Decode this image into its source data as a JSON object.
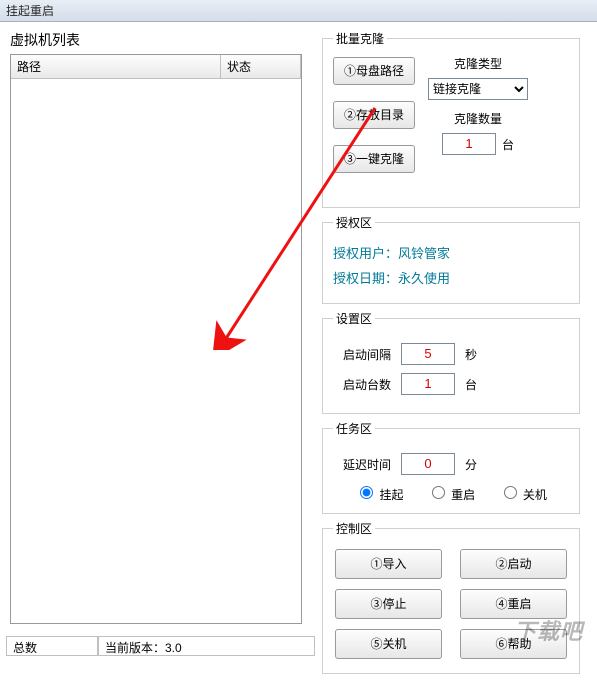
{
  "window": {
    "title": "挂起重启"
  },
  "left": {
    "list_label": "虚拟机列表",
    "col_path": "路径",
    "col_status": "状态"
  },
  "clone": {
    "legend": "批量克隆",
    "btn_base_disk": "①母盘路径",
    "btn_store": "②存放目录",
    "btn_one_key": "③一键克隆",
    "type_label": "克隆类型",
    "type_value": "链接克隆",
    "count_label": "克隆数量",
    "count_value": "1",
    "count_unit": "台"
  },
  "auth": {
    "legend": "授权区",
    "user_line": "授权用户：风铃管家",
    "date_line": "授权日期：永久使用"
  },
  "settings": {
    "legend": "设置区",
    "interval_label": "启动间隔",
    "interval_value": "5",
    "interval_unit": "秒",
    "count_label": "启动台数",
    "count_value": "1",
    "count_unit": "台"
  },
  "task": {
    "legend": "任务区",
    "delay_label": "延迟时间",
    "delay_value": "0",
    "delay_unit": "分",
    "radio_suspend": "挂起",
    "radio_restart": "重启",
    "radio_shutdown": "关机",
    "selected": "suspend"
  },
  "control": {
    "legend": "控制区",
    "btn_import": "①导入",
    "btn_start": "②启动",
    "btn_stop": "③停止",
    "btn_restart": "④重启",
    "btn_shutdown": "⑤关机",
    "btn_help": "⑥帮助"
  },
  "status": {
    "total_label": "总数",
    "version_label": "当前版本：3.0"
  },
  "watermark": "下载吧"
}
